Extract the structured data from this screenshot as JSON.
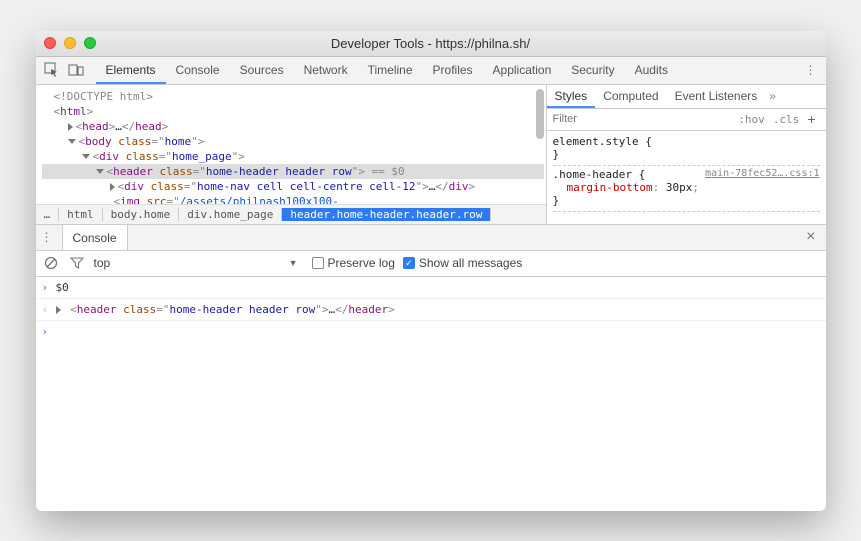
{
  "window": {
    "title": "Developer Tools - https://philna.sh/"
  },
  "mainTabs": [
    "Elements",
    "Console",
    "Sources",
    "Network",
    "Timeline",
    "Profiles",
    "Application",
    "Security",
    "Audits"
  ],
  "mainTabActive": 0,
  "dom": {
    "doctype": "<!DOCTYPE html>",
    "htmlOpen": "html",
    "headOpen": "head",
    "headEllipsis": "…",
    "headClose": "head",
    "bodyTag": "body",
    "bodyAttr": "class",
    "bodyVal": "home",
    "div1Tag": "div",
    "div1Attr": "class",
    "div1Val": "home_page",
    "headerTag": "header",
    "headerAttr": "class",
    "headerVal": "home-header header row",
    "selSuffix": " == $0",
    "div2Tag": "div",
    "div2Attr": "class",
    "div2Val": "home-nav cell cell-centre cell-12",
    "div2Ellipsis": "…",
    "div2Close": "div",
    "imgTag": "img",
    "imgAttr": "src",
    "imgVal": "/assets/philnash100x100-"
  },
  "crumbs": [
    "html",
    "body.home",
    "div.home_page",
    "header.home-header.header.row"
  ],
  "crumbSelected": 3,
  "crumbsEllipsis": "…",
  "stylesTabs": [
    "Styles",
    "Computed",
    "Event Listeners"
  ],
  "stylesTabActive": 0,
  "filter": {
    "placeholder": "Filter",
    "hov": ":hov",
    "cls": ".cls"
  },
  "rules": {
    "elStyle": {
      "sel": "element.style",
      "open": " {",
      "close": "}"
    },
    "r1": {
      "sel": ".home-header",
      "open": " {",
      "close": "}",
      "src": "main-78fec52….css:1",
      "prop": "margin-bottom",
      "val": "30px"
    }
  },
  "drawer": {
    "tab": "Console"
  },
  "consoleControls": {
    "context": "top",
    "preserve": "Preserve log",
    "showAll": "Show all messages"
  },
  "consoleLines": {
    "l1": "$0",
    "l2": {
      "tag": "header",
      "attr": "class",
      "val": "home-header header row",
      "ell": "…",
      "close": "header"
    }
  }
}
